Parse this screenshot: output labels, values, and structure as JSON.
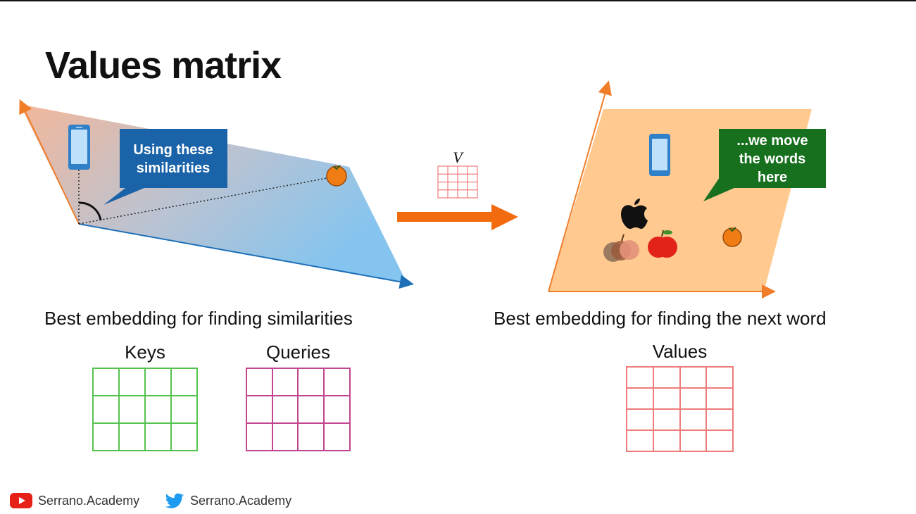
{
  "title": "Values matrix",
  "left_panel": {
    "callout": "Using these similarities",
    "callout_lines": [
      "Using these",
      "similarities"
    ],
    "caption": "Best embedding for finding similarities",
    "colors": {
      "orange": "#f07d2a",
      "blue": "#1d6fb8",
      "callout": "#1b63a8"
    }
  },
  "transform": {
    "label": "V",
    "arrow_color": "#f26b0f"
  },
  "right_panel": {
    "callout": "...we move the words here",
    "callout_lines": [
      "...we move",
      "the words",
      "here"
    ],
    "caption": "Best embedding for finding the next word",
    "colors": {
      "plane": "#ffc98f",
      "callout": "#17701e"
    }
  },
  "matrices": {
    "keys": {
      "label": "Keys",
      "color": "#55c24f"
    },
    "queries": {
      "label": "Queries",
      "color": "#c2458f"
    },
    "values": {
      "label": "Values",
      "color": "#ef7b7b"
    }
  },
  "footer": {
    "youtube": "Serrano.Academy",
    "twitter": "Serrano.Academy"
  }
}
